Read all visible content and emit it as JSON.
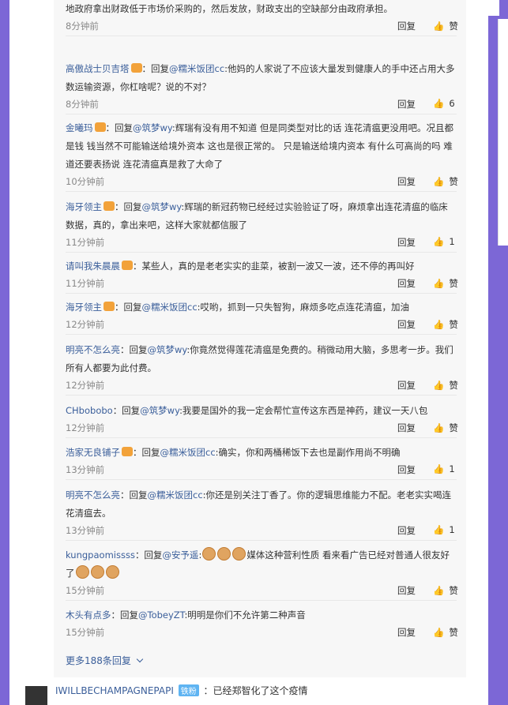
{
  "comments": [
    {
      "user": "",
      "text": "地政府拿出财政低于市场价采购的，然后发放，财政支出的空缺部分由政府承担。",
      "time": "8分钟前",
      "reply": "回复",
      "likes": "赞"
    },
    {
      "user": "高傲战士贝吉塔",
      "replyTo": "@糯米饭团cc",
      "text": ":他妈的人家说了不应该大量发到健康人的手中还占用大多数运输资源，你杠啥呢？说的不对？",
      "time": "8分钟前",
      "reply": "回复",
      "likes": "6"
    },
    {
      "user": "金曦玛",
      "replyTo": "@筑梦wy",
      "text": ":辉瑞有没有用不知道 但是同类型对比的话 连花清瘟更没用吧。况且都是钱 钱当然不可能输送给境外资本 这也是很正常的。 只是输送给境内资本 有什么可高尚的吗 难道还要表扬说 连花清瘟真是救了大命了",
      "time": "10分钟前",
      "reply": "回复",
      "likes": "赞"
    },
    {
      "user": "海牙领主",
      "replyTo": "@筑梦wy",
      "text": ":辉瑞的新冠药物已经经过实验验证了呀，麻烦拿出连花清瘟的临床数据，真的，拿出来吧，这样大家就都信服了",
      "time": "11分钟前",
      "reply": "回复",
      "likes": "1"
    },
    {
      "user": "请叫我朱晨晨",
      "replyTo": "",
      "text": "：某些人，真的是老老实实的韭菜，被割一波又一波，还不停的再叫好",
      "time": "11分钟前",
      "reply": "回复",
      "likes": "赞"
    },
    {
      "user": "海牙领主",
      "replyTo": "@糯米饭团cc",
      "text": ":哎哟，抓到一只失智狗，麻烦多吃点连花清瘟，加油",
      "time": "12分钟前",
      "reply": "回复",
      "likes": "赞"
    },
    {
      "user": "明亮不怎么亮",
      "replyTo": "@筑梦wy",
      "text": ":你竟然觉得莲花清瘟是免费的。稍微动用大脑，多思考一步。我们所有人都要为此付费。",
      "time": "12分钟前",
      "reply": "回复",
      "likes": "赞"
    },
    {
      "user": "CHbobobo",
      "replyTo": "@筑梦wy",
      "text": ":我要是国外的我一定会帮忙宣传这东西是神药，建议一天八包",
      "time": "12分钟前",
      "reply": "回复",
      "likes": "赞"
    },
    {
      "user": "浩家无良铺子",
      "replyTo": "@糯米饭团cc",
      "text": ":确实，你和两桶稀饭下去也是副作用尚不明确",
      "time": "13分钟前",
      "reply": "回复",
      "likes": "1"
    },
    {
      "user": "明亮不怎么亮",
      "replyTo": "@糯米饭团cc",
      "text": ":你还是别关注丁香了。你的逻辑思维能力不配。老老实实喝连花清瘟去。",
      "time": "13分钟前",
      "reply": "回复",
      "likes": "1"
    },
    {
      "user": "kungpaomissss",
      "replyTo": "@安予遥",
      "text": "媒体这种营利性质 看来看广告已经对普通人很友好了",
      "time": "15分钟前",
      "reply": "回复",
      "likes": "赞"
    },
    {
      "user": "木头有点多",
      "replyTo": "@TobeyZT",
      "text": ":明明是你们不允许第二种声音",
      "time": "15分钟前",
      "reply": "回复",
      "likes": "赞"
    }
  ],
  "more": "更多188条回复",
  "bottom": {
    "user": "IWILLBECHAMPAGNEPAPI",
    "badge": "铁粉",
    "text": "：已经郑智化了这个疫情"
  },
  "labels": {
    "reply_prefix": "：回复"
  }
}
